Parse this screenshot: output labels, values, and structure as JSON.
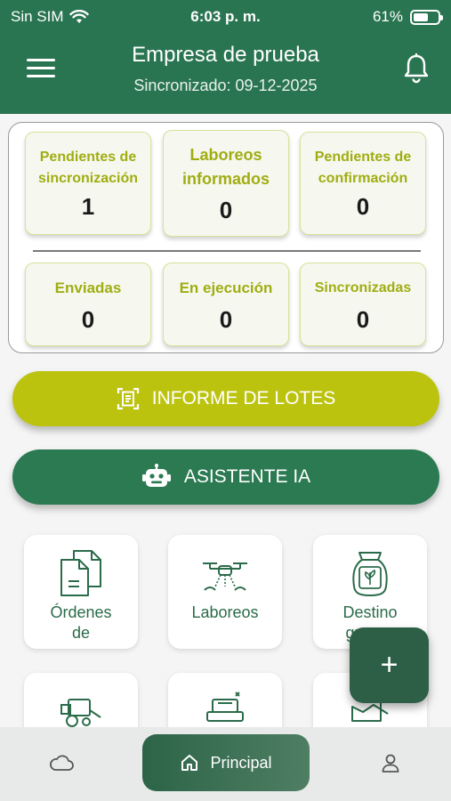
{
  "status_bar": {
    "carrier": "Sin SIM",
    "time": "6:03 p. m.",
    "battery_text": "61%",
    "battery_level": 0.61
  },
  "header": {
    "title": "Empresa de prueba",
    "sync_status": "Sincronizado: 09-12-2025",
    "menu_icon": "hamburger-icon",
    "notification_icon": "bell-icon"
  },
  "stats": [
    {
      "label_line1": "Pendientes de",
      "label_line2": "sincronización",
      "value": "1"
    },
    {
      "label_line1": "Laboreos",
      "label_line2": "informados",
      "value": "0"
    },
    {
      "label_line1": "Pendientes de",
      "label_line2": "confirmación",
      "value": "0"
    },
    {
      "label_line1": "Enviadas",
      "value": "0"
    },
    {
      "label_line1": "En ejecución",
      "value": "0"
    },
    {
      "label_line1": "Sincronizadas",
      "value": "0"
    }
  ],
  "actions": {
    "lotes": {
      "label": "INFORME DE LOTES",
      "icon": "document-scan-icon"
    },
    "ia": {
      "label": "ASISTENTE IA",
      "icon": "robot-icon"
    }
  },
  "tiles": [
    {
      "label_line1": "Órdenes",
      "label_line2": "de",
      "icon": "documents-icon"
    },
    {
      "label_line1": "Laboreos",
      "label_line2": "",
      "icon": "drone-icon"
    },
    {
      "label_line1": "Destino",
      "label_line2": "granos",
      "icon": "grain-bag-icon"
    },
    {
      "label_line1": "",
      "label_line2": "",
      "icon": "harvester-icon"
    },
    {
      "label_line1": "",
      "label_line2": "",
      "icon": "seeder-icon"
    },
    {
      "label_line1": "",
      "label_line2": "",
      "icon": "chart-icon"
    }
  ],
  "fab": {
    "label": "+"
  },
  "bottom_nav": {
    "home_label": "Principal",
    "left_icon": "cloud-icon",
    "right_icon": "user-icon"
  },
  "colors": {
    "primary": "#2a7551",
    "accent": "#bcc30f",
    "stat_label": "#a0ad12",
    "background": "#f4f5f4"
  }
}
